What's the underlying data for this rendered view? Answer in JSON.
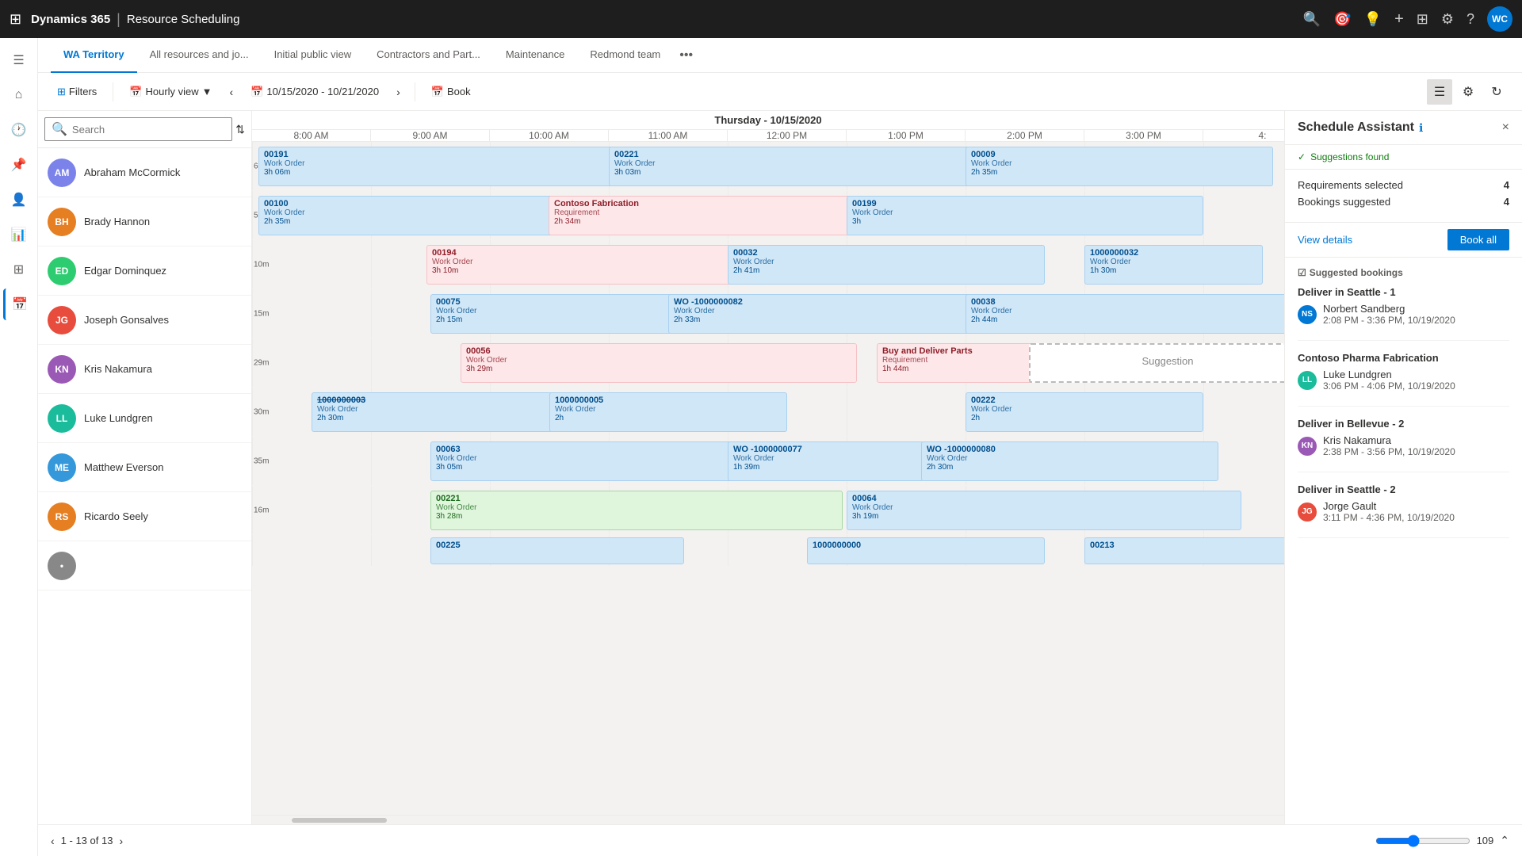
{
  "app": {
    "brand": "Dynamics 365",
    "separator": "|",
    "module": "Resource Scheduling",
    "user_initials": "WC"
  },
  "tabs": [
    {
      "id": "wa",
      "label": "WA Territory",
      "active": true
    },
    {
      "id": "all",
      "label": "All resources and jo..."
    },
    {
      "id": "initial",
      "label": "Initial public view"
    },
    {
      "id": "contractors",
      "label": "Contractors and Part..."
    },
    {
      "id": "maintenance",
      "label": "Maintenance"
    },
    {
      "id": "redmond",
      "label": "Redmond team"
    },
    {
      "id": "more",
      "label": "..."
    }
  ],
  "toolbar": {
    "filter_label": "Filters",
    "view_label": "Hourly view",
    "date_range": "10/15/2020 - 10/21/2020",
    "book_label": "Book"
  },
  "search": {
    "placeholder": "Search"
  },
  "timeline": {
    "day_label": "Thursday - 10/15/2020",
    "time_slots": [
      "8:00 AM",
      "9:00 AM",
      "10:00 AM",
      "11:00 AM",
      "12:00 PM",
      "1:00 PM",
      "2:00 PM",
      "3:00 PM",
      "4:"
    ]
  },
  "resources": [
    {
      "id": "am",
      "name": "Abraham McCormick",
      "initials": "AM",
      "color": "av-am"
    },
    {
      "id": "bh",
      "name": "Brady Hannon",
      "initials": "BH",
      "color": "av-bh"
    },
    {
      "id": "ed",
      "name": "Edgar Dominquez",
      "initials": "ED",
      "color": "av-ed"
    },
    {
      "id": "jgs",
      "name": "Joseph Gonsalves",
      "initials": "JG",
      "color": "av-jg"
    },
    {
      "id": "kn",
      "name": "Kris Nakamura",
      "initials": "KN",
      "color": "av-kn"
    },
    {
      "id": "ll",
      "name": "Luke Lundgren",
      "initials": "LL",
      "color": "av-ll"
    },
    {
      "id": "me",
      "name": "Matthew Everson",
      "initials": "ME",
      "color": "av-me"
    },
    {
      "id": "rs",
      "name": "Ricardo Seely",
      "initials": "RS",
      "color": "av-rs"
    }
  ],
  "schedule_assistant": {
    "title": "Schedule Assistant",
    "close_label": "×",
    "status": "Suggestions found",
    "requirements_selected_label": "Requirements selected",
    "requirements_selected_value": "4",
    "bookings_suggested_label": "Bookings suggested",
    "bookings_suggested_value": "4",
    "view_details_label": "View details",
    "book_all_label": "Book all",
    "suggested_bookings_label": "Suggested bookings",
    "suggestions": [
      {
        "title": "Deliver in Seattle - 1",
        "person": "Norbert Sandberg",
        "initials": "NS",
        "time": "2:08 PM - 3:36 PM, 10/19/2020"
      },
      {
        "title": "Contoso Pharma Fabrication",
        "person": "Luke Lundgren",
        "initials": "LL",
        "time": "3:06 PM - 4:06 PM, 10/19/2020"
      },
      {
        "title": "Deliver in Bellevue - 2",
        "person": "Kris Nakamura",
        "initials": "KN",
        "time": "2:38 PM - 3:56 PM, 10/19/2020"
      },
      {
        "title": "Deliver in Seattle - 2",
        "person": "Jorge Gault",
        "initials": "JG",
        "time": "3:11 PM - 4:36 PM, 10/19/2020"
      }
    ]
  },
  "pagination": {
    "current": "1 - 13 of 13"
  },
  "zoom": {
    "value": "109"
  }
}
